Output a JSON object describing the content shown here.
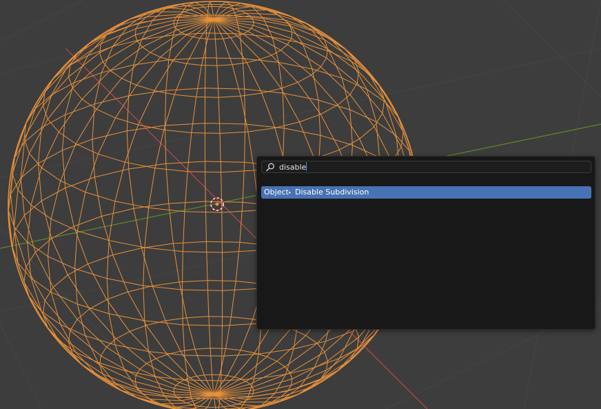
{
  "viewport": {
    "background_color": "#3d3d3d",
    "grid_color": "#454545",
    "x_axis_color": "#b94a4a",
    "y_axis_color": "#5e8a2a",
    "selection_color": "#e8913a",
    "origin_icon": "object-origin-icon"
  },
  "search_popup": {
    "search_icon": "search-icon",
    "query": "disable",
    "results": [
      {
        "category": "Object",
        "separator": "▸",
        "label": "Disable Subdivision",
        "highlighted": true
      }
    ],
    "highlight_color": "#4772b3"
  }
}
